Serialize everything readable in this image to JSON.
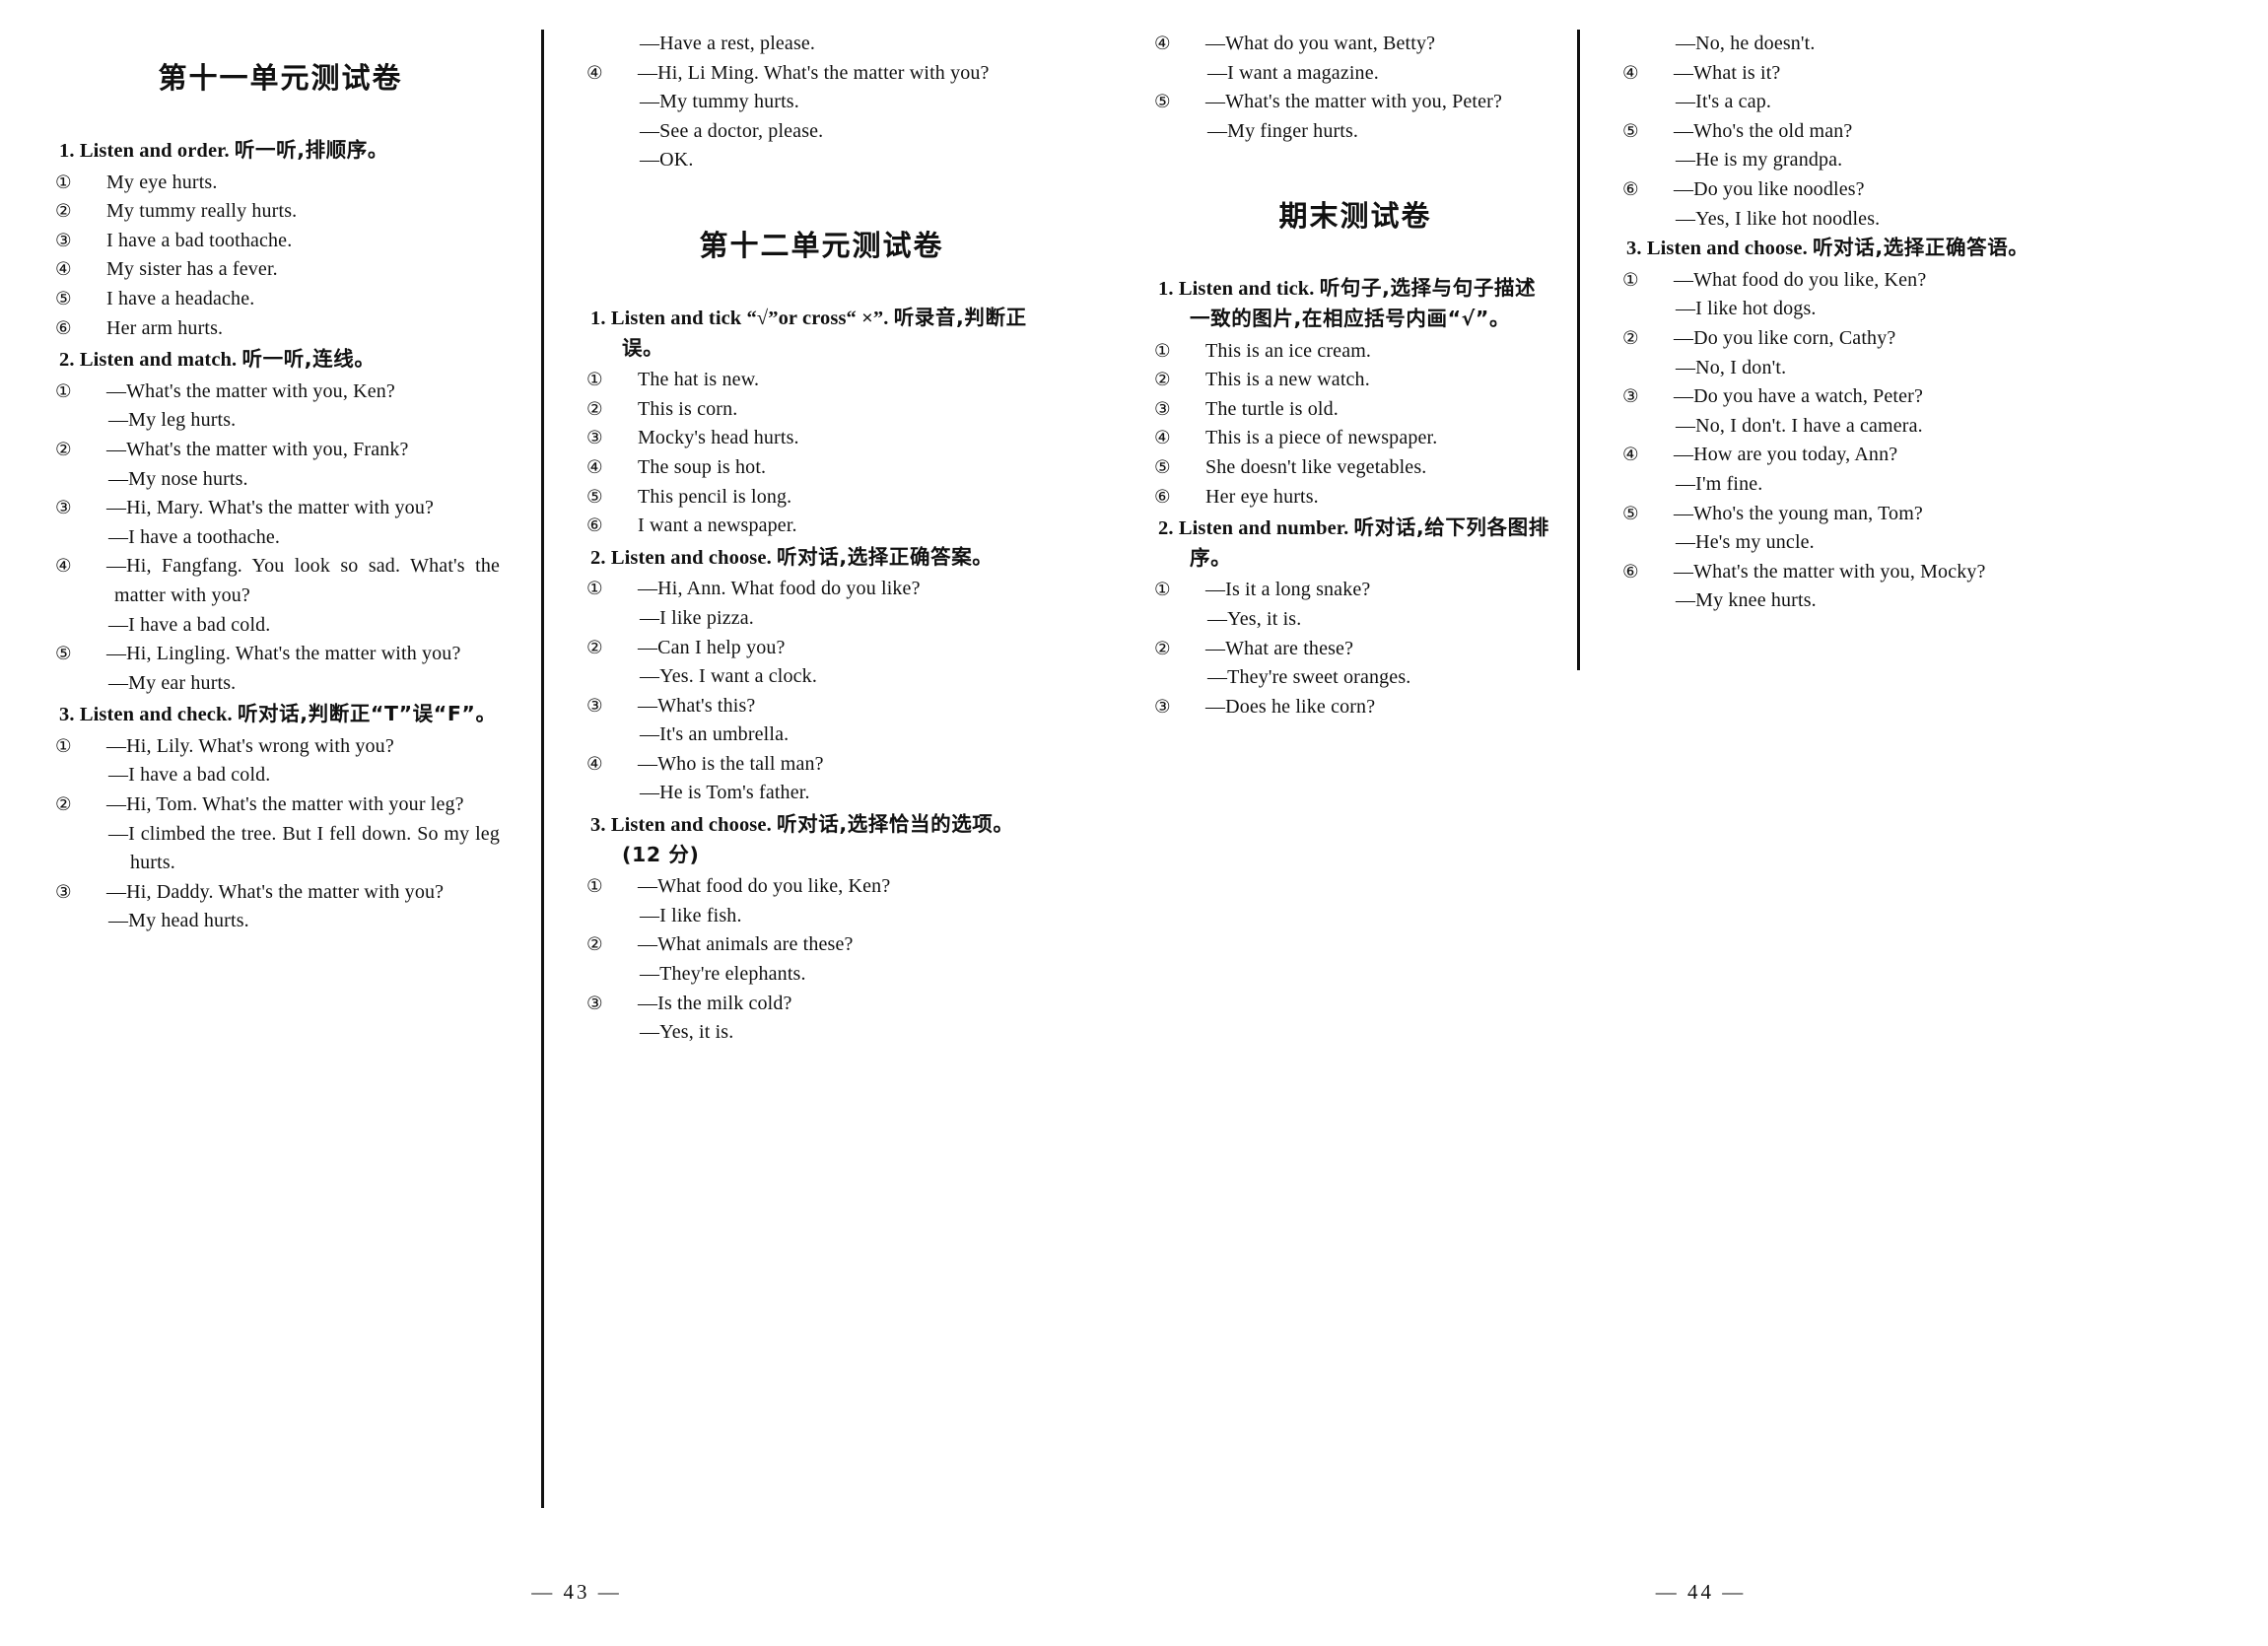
{
  "spread": {
    "left_page": {
      "folio": "— 43 —",
      "column1": {
        "title": "第十一单元测试卷",
        "tasks": [
          {
            "number": "1.",
            "en": "Listen and order.",
            "cn": "听一听,排顺序。",
            "items": [
              {
                "marker": "①",
                "text": "My eye hurts."
              },
              {
                "marker": "②",
                "text": "My tummy really hurts."
              },
              {
                "marker": "③",
                "text": "I have a bad toothache."
              },
              {
                "marker": "④",
                "text": "My sister has a fever."
              },
              {
                "marker": "⑤",
                "text": "I have a headache."
              },
              {
                "marker": "⑥",
                "text": "Her arm hurts."
              }
            ]
          },
          {
            "number": "2.",
            "en": "Listen and match.",
            "cn": "听一听,连线。",
            "items": [
              {
                "marker": "①",
                "text": "—What's the matter with you, Ken?"
              },
              {
                "marker": "",
                "text": "—My leg hurts."
              },
              {
                "marker": "②",
                "text": "—What's the matter with you, Frank?"
              },
              {
                "marker": "",
                "text": "—My nose hurts."
              },
              {
                "marker": "③",
                "text": "—Hi, Mary.  What's the matter with you?"
              },
              {
                "marker": "",
                "text": "—I have a toothache."
              },
              {
                "marker": "④",
                "text": "—Hi, Fangfang.  You look so sad.  What's the matter with you?"
              },
              {
                "marker": "",
                "text": "—I have a bad cold."
              },
              {
                "marker": "⑤",
                "text": "—Hi, Lingling.  What's the matter with you?"
              },
              {
                "marker": "",
                "text": "—My ear hurts."
              }
            ]
          },
          {
            "number": "3.",
            "en": "Listen and check.",
            "cn": "听对话,判断正“T”误“F”。",
            "items": [
              {
                "marker": "①",
                "text": "—Hi, Lily.  What's wrong with you?"
              },
              {
                "marker": "",
                "text": "—I have a bad cold."
              },
              {
                "marker": "②",
                "text": "—Hi, Tom.  What's the matter with your leg?"
              },
              {
                "marker": "",
                "text": "—I climbed the tree.  But I fell down.  So my leg hurts."
              },
              {
                "marker": "③",
                "text": "—Hi, Daddy.  What's the matter with you?"
              },
              {
                "marker": "",
                "text": "—My head hurts."
              }
            ]
          }
        ]
      },
      "column2": {
        "continued": [
          {
            "marker": "",
            "text": "—Have a rest, please."
          },
          {
            "marker": "④",
            "text": "—Hi, Li Ming.  What's the matter with you?"
          },
          {
            "marker": "",
            "text": "—My tummy hurts."
          },
          {
            "marker": "",
            "text": "—See a doctor, please."
          },
          {
            "marker": "",
            "text": "—OK."
          }
        ],
        "title": "第十二单元测试卷",
        "tasks": [
          {
            "number": "1.",
            "en": "Listen and tick “√”or cross“ ×”.",
            "cn": "听录音,判断正误。",
            "items": [
              {
                "marker": "①",
                "text": "The hat is new."
              },
              {
                "marker": "②",
                "text": "This is corn."
              },
              {
                "marker": "③",
                "text": "Mocky's head hurts."
              },
              {
                "marker": "④",
                "text": "The soup is hot."
              },
              {
                "marker": "⑤",
                "text": "This pencil is long."
              },
              {
                "marker": "⑥",
                "text": "I want a newspaper."
              }
            ]
          },
          {
            "number": "2.",
            "en": "Listen and choose.",
            "cn": "听对话,选择正确答案。",
            "items": [
              {
                "marker": "①",
                "text": "—Hi, Ann.  What food do you like?"
              },
              {
                "marker": "",
                "text": "—I like pizza."
              },
              {
                "marker": "②",
                "text": "—Can I help you?"
              },
              {
                "marker": "",
                "text": "—Yes.  I want a clock."
              },
              {
                "marker": "③",
                "text": "—What's this?"
              },
              {
                "marker": "",
                "text": "—It's an umbrella."
              },
              {
                "marker": "④",
                "text": "—Who is the tall man?"
              },
              {
                "marker": "",
                "text": "—He is Tom's father."
              }
            ]
          },
          {
            "number": "3.",
            "en": "Listen and choose.",
            "cn": "听对话,选择恰当的选项。(12 分)",
            "items": [
              {
                "marker": "①",
                "text": "—What food do you like, Ken?"
              },
              {
                "marker": "",
                "text": "—I like fish."
              },
              {
                "marker": "②",
                "text": "—What animals are these?"
              },
              {
                "marker": "",
                "text": "—They're elephants."
              },
              {
                "marker": "③",
                "text": "—Is the milk cold?"
              },
              {
                "marker": "",
                "text": "—Yes, it is."
              }
            ]
          }
        ]
      }
    },
    "right_page": {
      "folio": "— 44 —",
      "column3": {
        "continued": [
          {
            "marker": "④",
            "text": "—What do you want, Betty?"
          },
          {
            "marker": "",
            "text": "—I want a magazine."
          },
          {
            "marker": "⑤",
            "text": "—What's the matter with you, Peter?"
          },
          {
            "marker": "",
            "text": "—My finger hurts."
          }
        ],
        "title": "期末测试卷",
        "tasks": [
          {
            "number": "1.",
            "en": "Listen and tick.",
            "cn": "听句子,选择与句子描述一致的图片,在相应括号内画“√”。",
            "items": [
              {
                "marker": "①",
                "text": "This is an ice cream."
              },
              {
                "marker": "②",
                "text": "This is a new watch."
              },
              {
                "marker": "③",
                "text": "The turtle is old."
              },
              {
                "marker": "④",
                "text": "This is a piece of newspaper."
              },
              {
                "marker": "⑤",
                "text": "She doesn't like vegetables."
              },
              {
                "marker": "⑥",
                "text": "Her eye hurts."
              }
            ]
          },
          {
            "number": "2.",
            "en": "Listen and number.",
            "cn": "听对话,给下列各图排序。",
            "items": [
              {
                "marker": "①",
                "text": "—Is it a long snake?"
              },
              {
                "marker": "",
                "text": "—Yes, it is."
              },
              {
                "marker": "②",
                "text": "—What are these?"
              },
              {
                "marker": "",
                "text": "—They're sweet oranges."
              },
              {
                "marker": "③",
                "text": "—Does he like corn?"
              }
            ]
          }
        ]
      },
      "column4": {
        "continued": [
          {
            "marker": "",
            "text": "—No, he doesn't."
          },
          {
            "marker": "④",
            "text": "—What is it?"
          },
          {
            "marker": "",
            "text": "—It's a cap."
          },
          {
            "marker": "⑤",
            "text": "—Who's the old man?"
          },
          {
            "marker": "",
            "text": "—He is my grandpa."
          },
          {
            "marker": "⑥",
            "text": "—Do you like noodles?"
          },
          {
            "marker": "",
            "text": "—Yes, I like hot noodles."
          }
        ],
        "tasks": [
          {
            "number": "3.",
            "en": "Listen and choose.",
            "cn": "听对话,选择正确答语。",
            "items": [
              {
                "marker": "①",
                "text": "—What food do you like, Ken?"
              },
              {
                "marker": "",
                "text": "—I like hot dogs."
              },
              {
                "marker": "②",
                "text": "—Do you like corn, Cathy?"
              },
              {
                "marker": "",
                "text": "—No, I don't."
              },
              {
                "marker": "③",
                "text": "—Do you have a watch, Peter?"
              },
              {
                "marker": "",
                "text": "—No, I don't.  I have a camera."
              },
              {
                "marker": "④",
                "text": "—How are you today, Ann?"
              },
              {
                "marker": "",
                "text": "—I'm fine."
              },
              {
                "marker": "⑤",
                "text": "—Who's the young man, Tom?"
              },
              {
                "marker": "",
                "text": "—He's my uncle."
              },
              {
                "marker": "⑥",
                "text": "—What's the matter with you, Mocky?"
              },
              {
                "marker": "",
                "text": "—My knee hurts."
              }
            ]
          }
        ]
      }
    }
  }
}
